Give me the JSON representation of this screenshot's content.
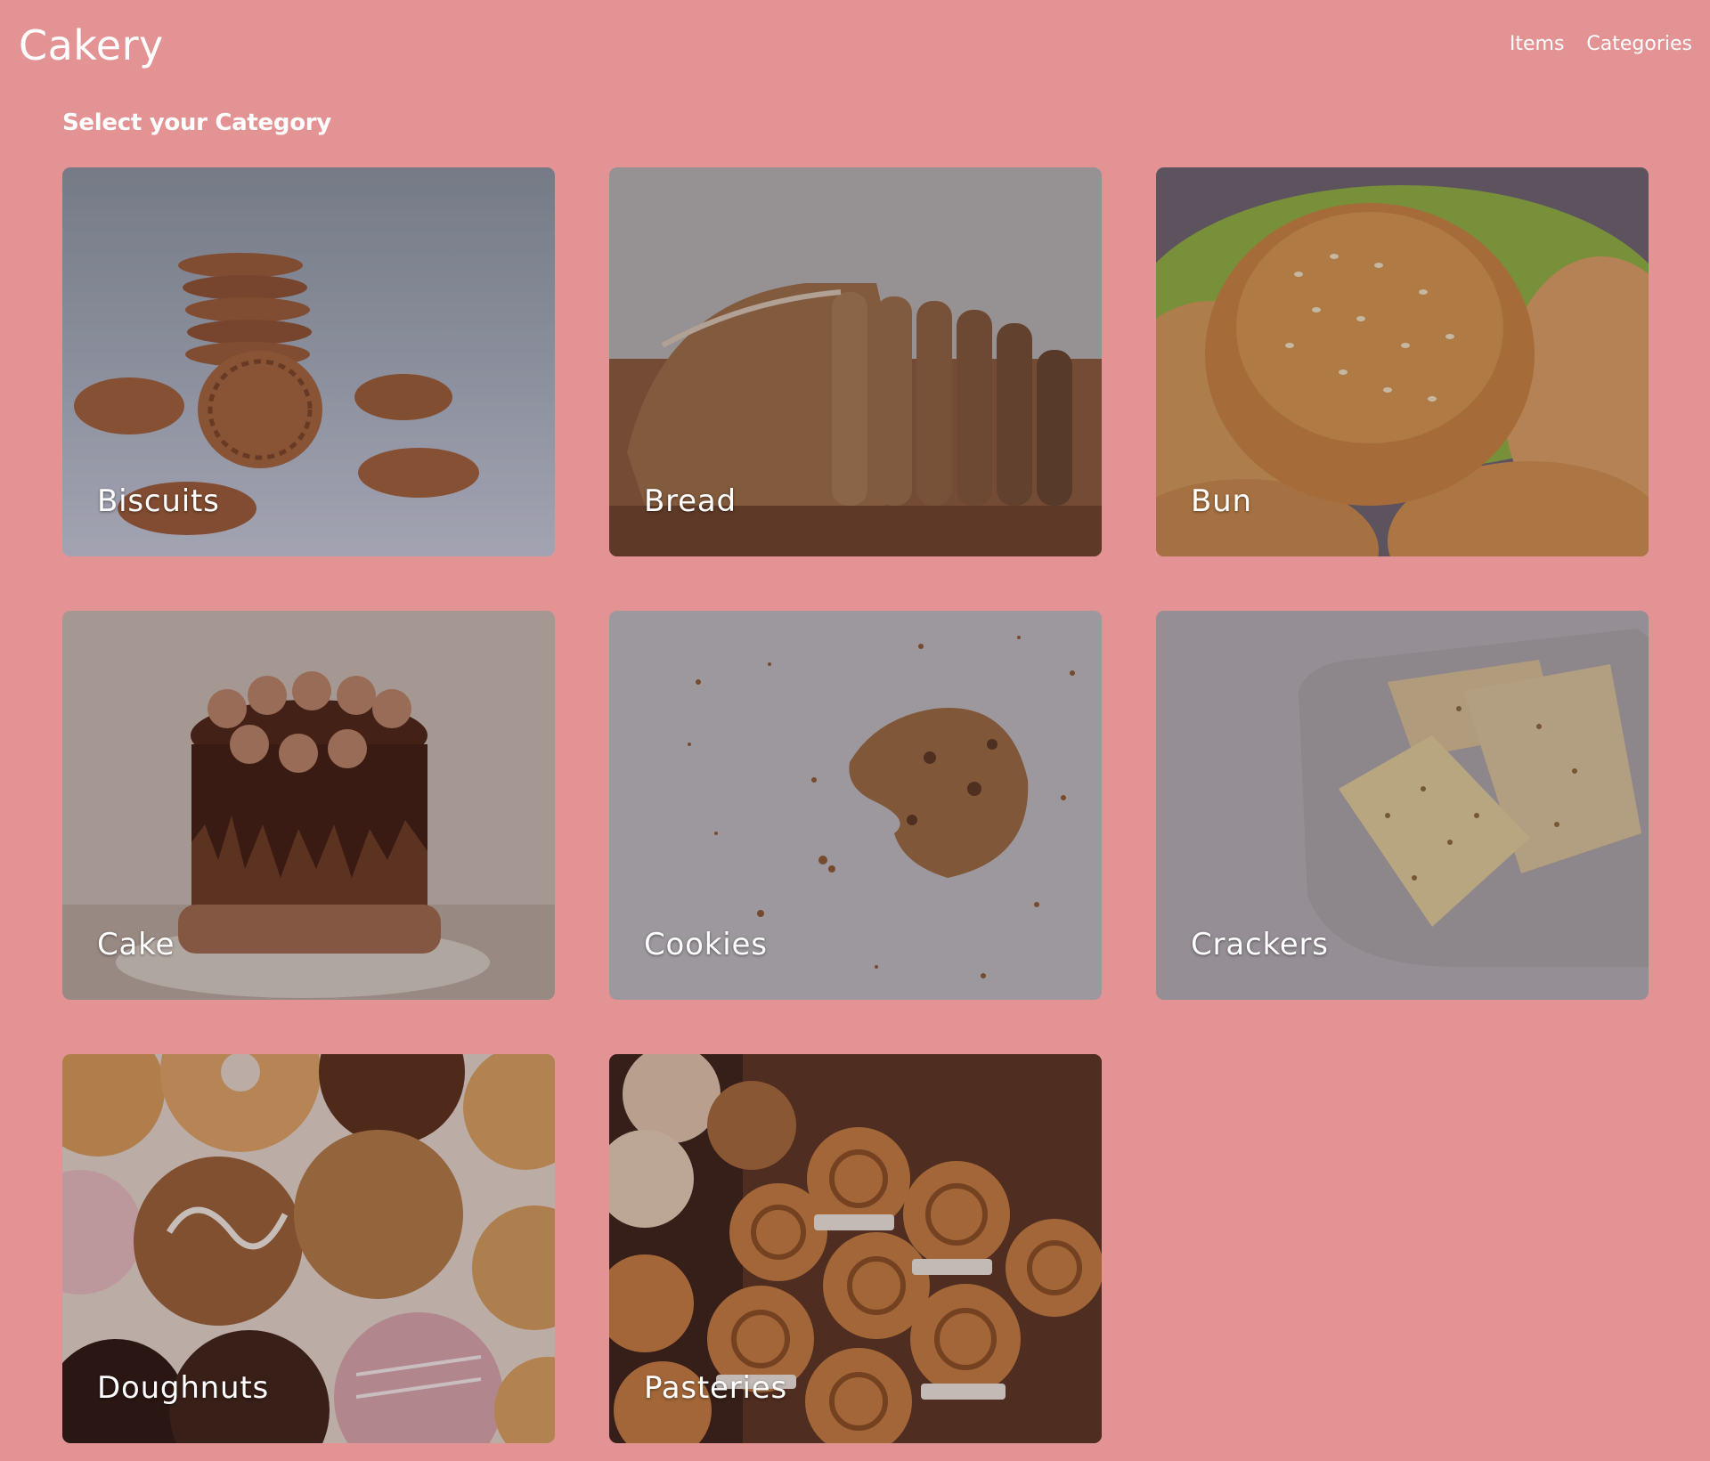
{
  "app": {
    "title": "Cakery"
  },
  "nav": {
    "items": [
      {
        "label": "Items"
      },
      {
        "label": "Categories"
      }
    ]
  },
  "main": {
    "heading": "Select your Category",
    "categories": [
      {
        "label": "Biscuits"
      },
      {
        "label": "Bread"
      },
      {
        "label": "Bun"
      },
      {
        "label": "Cake"
      },
      {
        "label": "Cookies"
      },
      {
        "label": "Crackers"
      },
      {
        "label": "Doughnuts"
      },
      {
        "label": "Pasteries"
      }
    ]
  },
  "colors": {
    "page_background": "#e39393",
    "text": "#ffffff"
  }
}
